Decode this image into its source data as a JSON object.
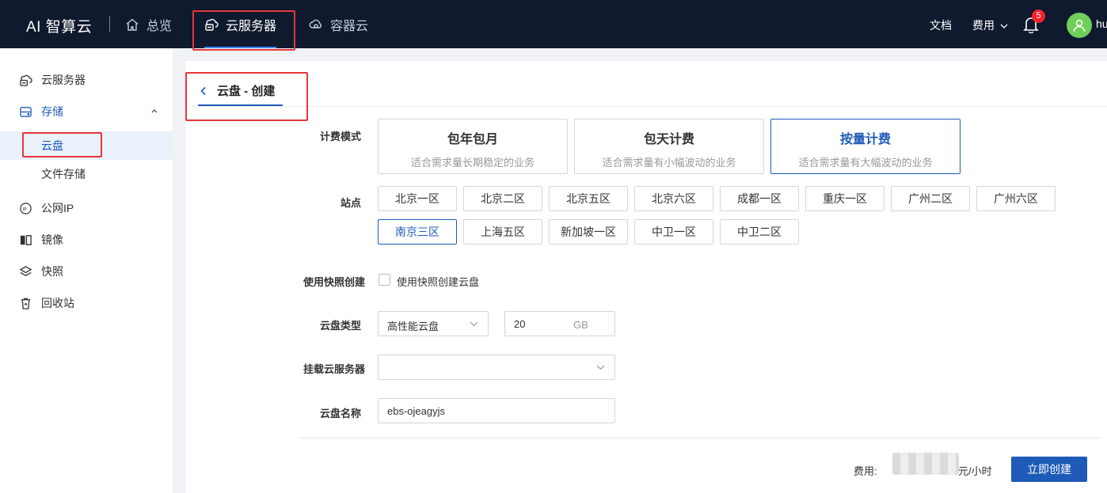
{
  "header": {
    "brand": "AI 智算云",
    "nav": [
      {
        "label": "总览",
        "icon": "home-icon"
      },
      {
        "label": "云服务器",
        "icon": "cloud-server-icon"
      },
      {
        "label": "容器云",
        "icon": "container-cloud-icon"
      }
    ],
    "docs_label": "文档",
    "fees_label": "费用",
    "notification_count": "5",
    "username": "hu"
  },
  "sidebar": {
    "items": [
      {
        "label": "云服务器",
        "icon": "cloud-server-icon"
      },
      {
        "label": "存储",
        "icon": "storage-icon"
      },
      {
        "label": "云盘"
      },
      {
        "label": "文件存储"
      },
      {
        "label": "公网IP",
        "icon": "ip-icon"
      },
      {
        "label": "镜像",
        "icon": "image-icon"
      },
      {
        "label": "快照",
        "icon": "snapshot-icon"
      },
      {
        "label": "回收站",
        "icon": "recycle-bin-icon"
      }
    ]
  },
  "page": {
    "title": "云盘 - 创建"
  },
  "form": {
    "billing_label": "计费模式",
    "billing_options": [
      {
        "title": "包年包月",
        "desc": "适合需求量长期稳定的业务"
      },
      {
        "title": "包天计费",
        "desc": "适合需求量有小幅波动的业务"
      },
      {
        "title": "按量计费",
        "desc": "适合需求量有大幅波动的业务"
      }
    ],
    "selected_billing": "按量计费",
    "site_label": "站点",
    "sites": [
      "北京一区",
      "北京二区",
      "北京五区",
      "北京六区",
      "成都一区",
      "重庆一区",
      "广州二区",
      "广州六区",
      "南京三区",
      "上海五区",
      "新加坡一区",
      "中卫一区",
      "中卫二区"
    ],
    "selected_site": "南京三区",
    "snapshot_label": "使用快照创建",
    "snapshot_checkbox_label": "使用快照创建云盘",
    "disk_type_label": "云盘类型",
    "disk_type_value": "高性能云盘",
    "size_value": "20",
    "size_unit": "GB",
    "mount_label": "挂载云服务器",
    "mount_value": "",
    "name_label": "云盘名称",
    "name_value": "ebs-ojeagyjs"
  },
  "footer": {
    "fee_label": "费用:",
    "fee_unit": "元/小时",
    "create_label": "立即创建"
  },
  "colors": {
    "topbar": "#0f1a2e",
    "accent": "#1e5bb8",
    "annotation": "#e8363b"
  }
}
